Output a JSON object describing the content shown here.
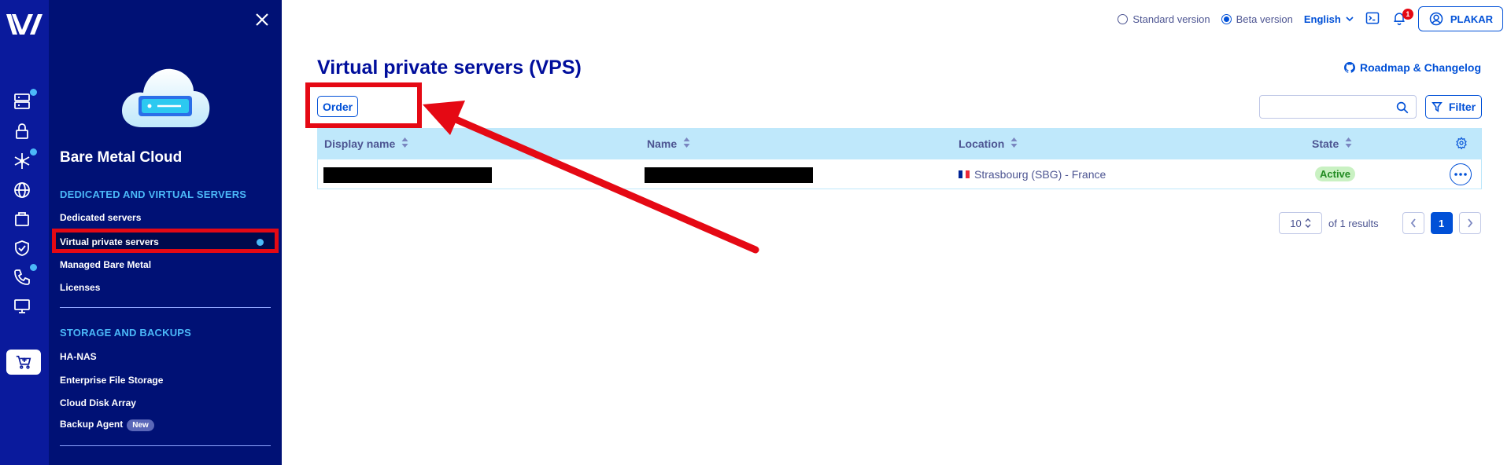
{
  "colors": {
    "rail": "#0a1a9c",
    "sidebar": "#001175",
    "accent": "#0050d7",
    "highlight": "#e50914",
    "table_header": "#bfe8fb",
    "status_active_bg": "#c9f1c2"
  },
  "rail": {
    "icons": [
      "logo-icon",
      "server-icon",
      "lock-icon",
      "network-icon",
      "globe-icon",
      "package-icon",
      "shield-check-icon",
      "phone-icon",
      "monitor-icon",
      "cart-plus-icon"
    ]
  },
  "sidebar": {
    "title": "Bare Metal Cloud",
    "sections": [
      {
        "heading": "DEDICATED AND VIRTUAL SERVERS",
        "items": [
          "Dedicated servers",
          "Virtual private servers",
          "Managed Bare Metal",
          "Licenses"
        ]
      },
      {
        "heading": "STORAGE AND BACKUPS",
        "items": [
          "HA-NAS",
          "Enterprise File Storage",
          "Cloud Disk Array",
          "Backup Agent"
        ]
      }
    ],
    "new_badge": "New"
  },
  "topbar": {
    "standard_version": "Standard version",
    "beta_version": "Beta version",
    "language": "English",
    "notification_count": "1",
    "user": "PLAKAR"
  },
  "main": {
    "title": "Virtual private servers (VPS)",
    "roadmap": "Roadmap & Changelog",
    "order": "Order",
    "filter": "Filter",
    "search_placeholder": "",
    "table": {
      "headers": [
        "Display name",
        "Name",
        "Location",
        "State"
      ],
      "rows": [
        {
          "location": "Strasbourg (SBG) - France",
          "state": "Active"
        }
      ]
    },
    "pagination": {
      "page_size": "10",
      "results": "of 1 results",
      "current_page": "1"
    }
  }
}
